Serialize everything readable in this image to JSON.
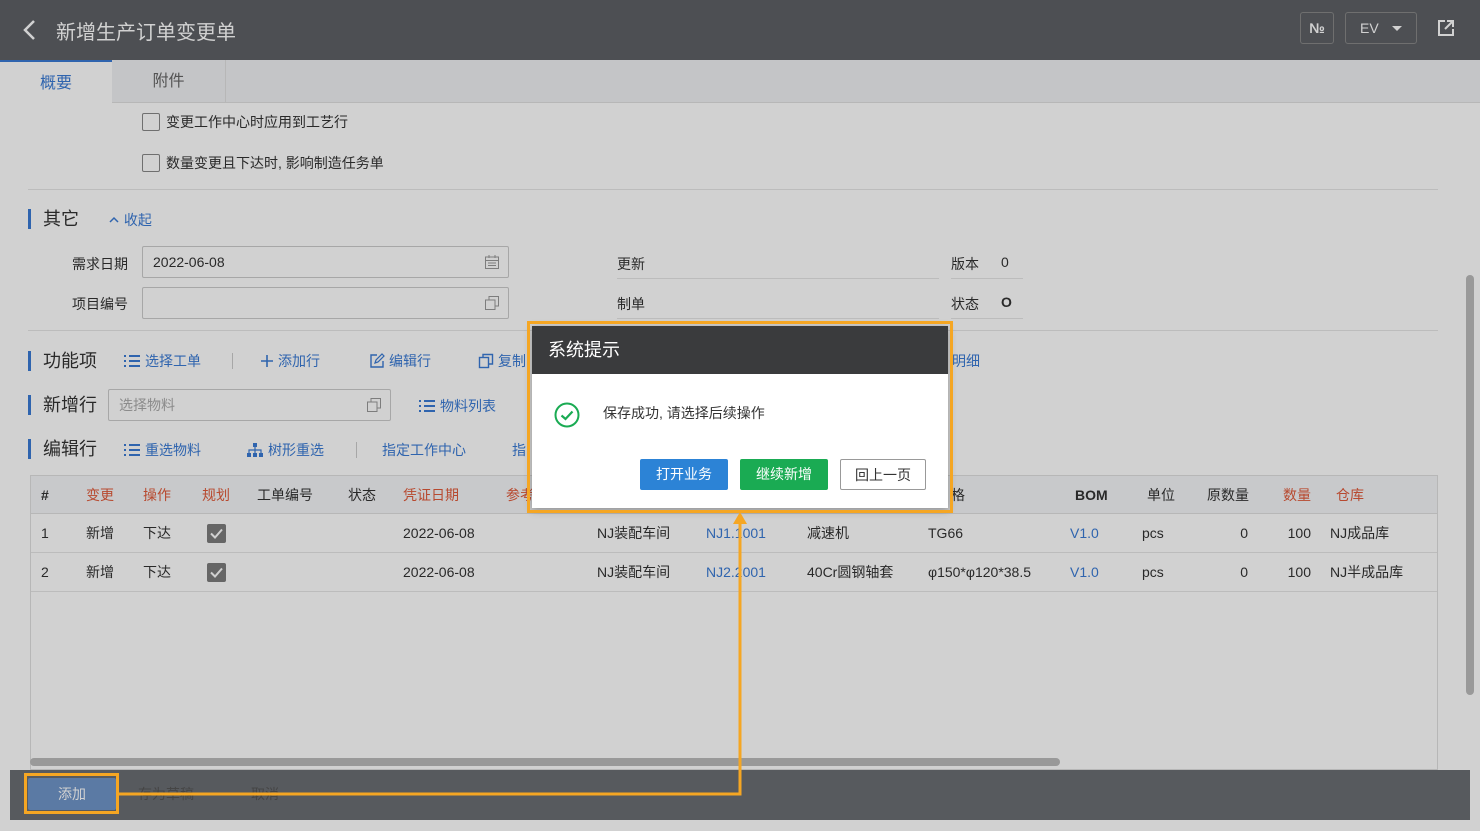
{
  "header": {
    "title": "新增生产订单变更单",
    "no_label": "№",
    "lang_label": "EV"
  },
  "tabs": [
    {
      "label": "概要"
    },
    {
      "label": "附件"
    }
  ],
  "options": {
    "apply_workcenter": "变更工作中心时应用到工艺行",
    "affect_task": "数量变更且下达时, 影响制造任务单"
  },
  "other": {
    "title": "其它",
    "collapse_label": "收起",
    "demand_date_label": "需求日期",
    "demand_date_value": "2022-06-08",
    "project_no_label": "项目编号",
    "project_no_value": "",
    "update_label": "更新",
    "maker_label": "制单",
    "version_label": "版本",
    "version_value": "0",
    "status_label": "状态",
    "status_value": "O"
  },
  "functions": {
    "title": "功能项",
    "select_order": "选择工单",
    "add_row": "添加行",
    "edit_row": "编辑行",
    "copy": "复制",
    "detail": "明细"
  },
  "new_row": {
    "title": "新增行",
    "material_placeholder": "选择物料",
    "material_list": "物料列表"
  },
  "edit_row": {
    "title": "编辑行",
    "reselect": "重选物料",
    "tree_reselect": "树形重选",
    "assign_wc": "指定工作中心",
    "assign_other": "指"
  },
  "grid": {
    "headers": {
      "idx": "#",
      "change": "变更",
      "op": "操作",
      "plan": "规划",
      "order_no": "工单编号",
      "status": "状态",
      "doc_date": "凭证日期",
      "ref": "参考",
      "spec": "格",
      "bom": "BOM",
      "unit": "单位",
      "orig_qty": "原数量",
      "qty": "数量",
      "warehouse": "仓库"
    },
    "rows": [
      {
        "idx": "1",
        "change": "新增",
        "op": "下达",
        "date": "2022-06-08",
        "workshop": "NJ装配车间",
        "item": "NJ1.1001",
        "name": "减速机",
        "spec": "TG66",
        "bom": "V1.0",
        "unit": "pcs",
        "orig": "0",
        "qty": "100",
        "wh": "NJ成品库"
      },
      {
        "idx": "2",
        "change": "新增",
        "op": "下达",
        "date": "2022-06-08",
        "workshop": "NJ装配车间",
        "item": "NJ2.2001",
        "name": "40Cr圆钢轴套",
        "spec": "φ150*φ120*38.5",
        "bom": "V1.0",
        "unit": "pcs",
        "orig": "0",
        "qty": "100",
        "wh": "NJ半成品库"
      }
    ]
  },
  "footer": {
    "add": "添加",
    "draft": "存为草稿",
    "cancel": "取消"
  },
  "dialog": {
    "title": "系统提示",
    "message": "保存成功, 请选择后续操作",
    "open_btn": "打开业务",
    "continue_btn": "继续新增",
    "back_btn": "回上一页"
  },
  "colors": {
    "accent": "#3a7bd5",
    "highlight": "#f5a623",
    "success": "#1aab53",
    "primary_btn": "#2c83d6",
    "required_header": "#e05a3a"
  }
}
